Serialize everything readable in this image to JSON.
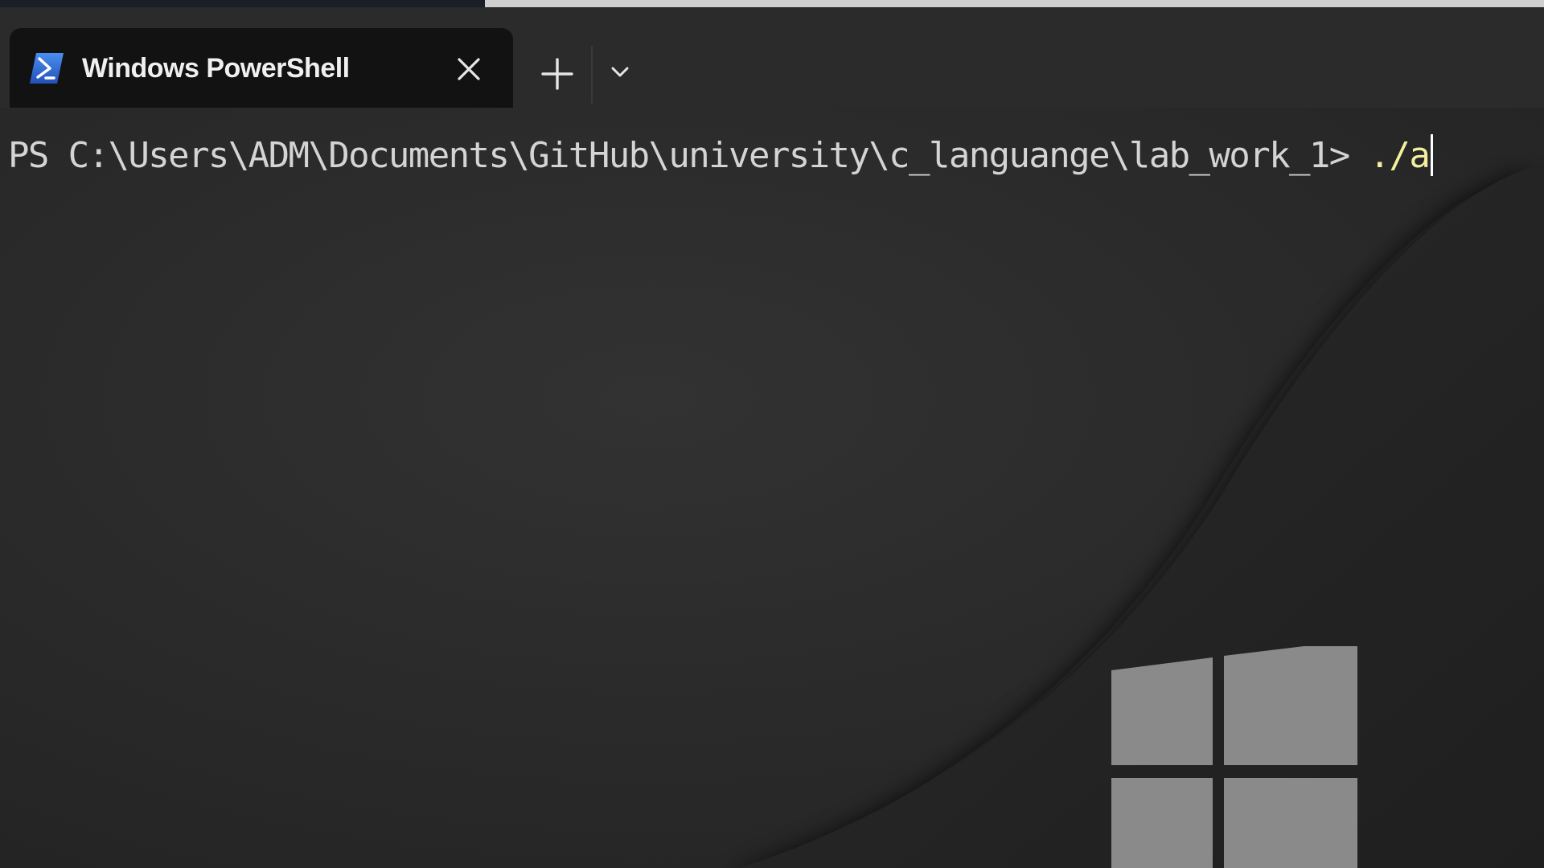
{
  "window": {
    "tab": {
      "title": "Windows PowerShell",
      "icon": "powershell-icon",
      "close_icon": "close-icon"
    },
    "new_tab_icon": "plus-icon",
    "dropdown_icon": "chevron-down-icon"
  },
  "terminal": {
    "prompt": "PS C:\\Users\\ADM\\Documents\\GitHub\\university\\c_languange\\lab_work_1> ",
    "command": "./a"
  },
  "colors": {
    "prompt_text": "#d4d4d4",
    "command_text": "#f3ef9e",
    "tab_active_bg": "#121212",
    "tab_bar_bg": "#2b2b2b",
    "powershell_icon_bg": "#2f6fd6"
  },
  "wallpaper": {
    "logo": "windows-logo"
  }
}
